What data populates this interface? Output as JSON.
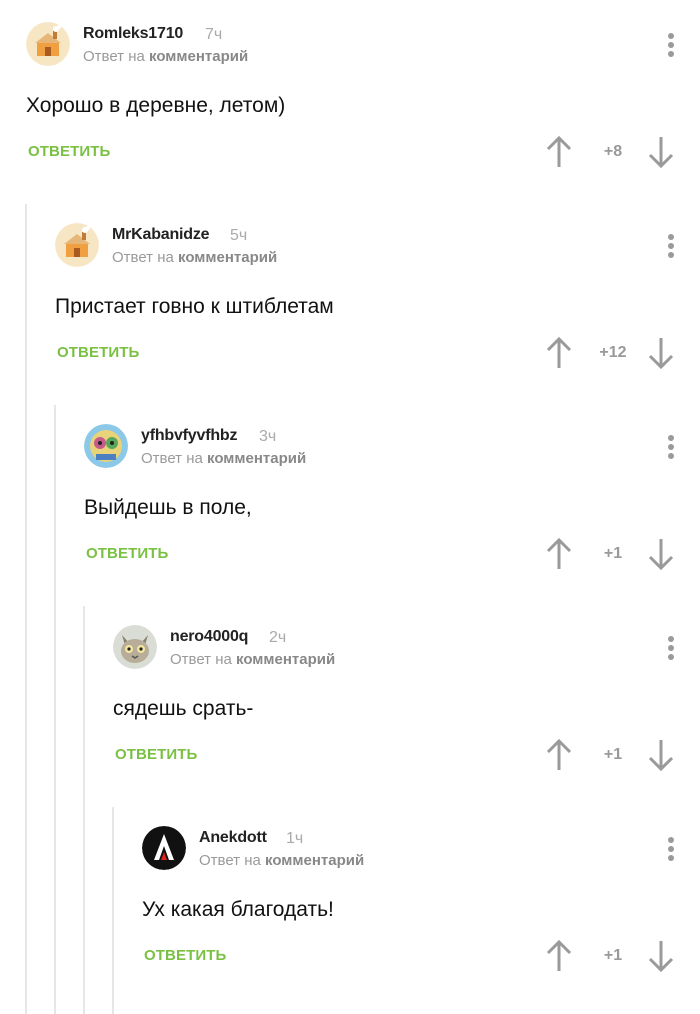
{
  "comments": [
    {
      "author": "Romleks1710",
      "time": "7ч",
      "reply_prefix": "Ответ на",
      "reply_target": "комментарий",
      "text": "Хорошо в деревне, летом)",
      "reply_label": "ОТВЕТИТЬ",
      "rating": "+8",
      "avatar": "house-avatar"
    },
    {
      "author": "MrKabanidze",
      "time": "5ч",
      "reply_prefix": "Ответ на",
      "reply_target": "комментарий",
      "text": "Пристает говно к штиблетам",
      "reply_label": "ОТВЕТИТЬ",
      "rating": "+12",
      "avatar": "house-avatar"
    },
    {
      "author": "yfhbvfyvfhbz",
      "time": "3ч",
      "reply_prefix": "Ответ на",
      "reply_target": "комментарий",
      "text": "Выйдешь в поле,",
      "reply_label": "ОТВЕТИТЬ",
      "rating": "+1",
      "avatar": "cartoon-avatar"
    },
    {
      "author": "nero4000q",
      "time": "2ч",
      "reply_prefix": "Ответ на",
      "reply_target": "комментарий",
      "text": "сядешь срать-",
      "reply_label": "ОТВЕТИТЬ",
      "rating": "+1",
      "avatar": "cat-avatar"
    },
    {
      "author": "Anekdott",
      "time": "1ч",
      "reply_prefix": "Ответ на",
      "reply_target": "комментарий",
      "text": "Ух какая благодать!",
      "reply_label": "ОТВЕТИТЬ",
      "rating": "+1",
      "avatar": "letter-a-avatar"
    }
  ],
  "colors": {
    "accent": "#7ac143",
    "muted": "#9a9a9a",
    "thread_line": "#e6e6e6"
  }
}
